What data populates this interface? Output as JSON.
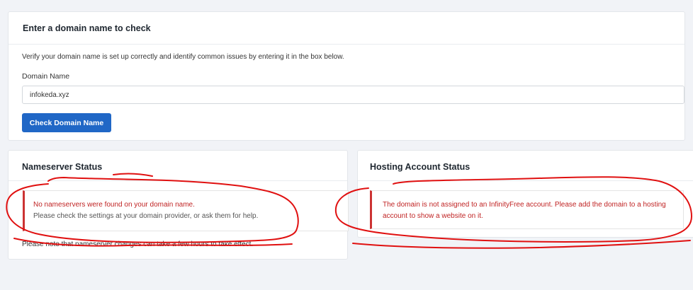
{
  "check": {
    "title": "Enter a domain name to check",
    "intro": "Verify your domain name is set up correctly and identify common issues by entering it in the box below.",
    "field_label": "Domain Name",
    "domain_value": "infokeda.xyz",
    "button_label": "Check Domain Name"
  },
  "nameserver": {
    "title": "Nameserver Status",
    "alert_title": "No nameservers were found on your domain name.",
    "alert_body": "Please check the settings at your domain provider, or ask them for help.",
    "note": "Please note that nameserver changes can take a few hours to take effect."
  },
  "hosting": {
    "title": "Hosting Account Status",
    "alert_text": "The domain is not assigned to an InfinityFree account. Please add the domain to a hosting account to show a website on it."
  },
  "colors": {
    "primary_button": "#2067c6",
    "error_text": "#c02424",
    "annotation_ink": "#e01010"
  }
}
